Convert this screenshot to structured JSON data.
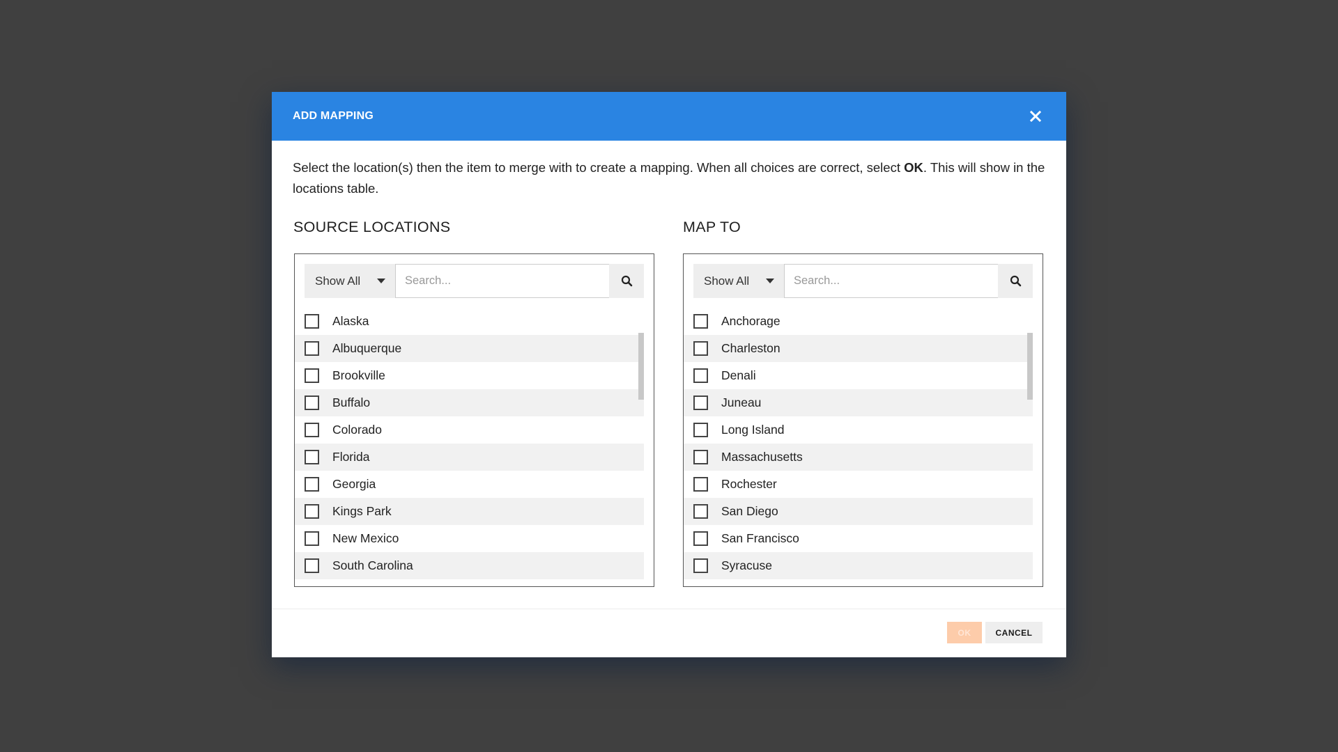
{
  "modal": {
    "title": "ADD MAPPING",
    "instructions": {
      "before": "Select the location(s) then the item to merge with to create a mapping. When all choices are correct, select ",
      "bold": "OK",
      "after": ". This will show in the locations table."
    }
  },
  "source": {
    "title": "SOURCE LOCATIONS",
    "filter_label": "Show All",
    "search_placeholder": "Search...",
    "items": [
      "Alaska",
      "Albuquerque",
      "Brookville",
      "Buffalo",
      "Colorado",
      "Florida",
      "Georgia",
      "Kings Park",
      "New Mexico",
      "South Carolina"
    ]
  },
  "target": {
    "title": "MAP TO",
    "filter_label": "Show All",
    "search_placeholder": "Search...",
    "items": [
      "Anchorage",
      "Charleston",
      "Denali",
      "Juneau",
      "Long Island",
      "Massachusetts",
      "Rochester",
      "San Diego",
      "San Francisco",
      "Syracuse"
    ]
  },
  "footer": {
    "ok_label": "OK",
    "cancel_label": "CANCEL"
  },
  "colors": {
    "header": "#2a84e2",
    "ok_disabled": "#fdccaa"
  },
  "icons": {
    "close": "close-icon",
    "search": "search-icon",
    "dropdown": "chevron-down-icon"
  }
}
